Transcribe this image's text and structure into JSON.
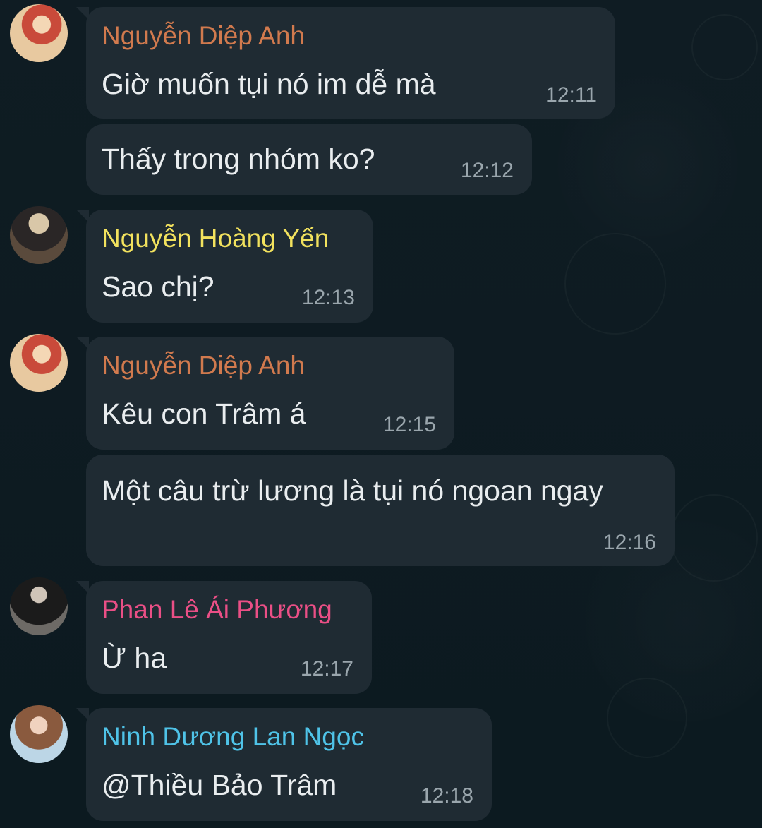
{
  "colors": {
    "background": "#0e1b22",
    "bubble": "#1f2b33",
    "text": "#e9edef",
    "time": "#9aa6ad"
  },
  "messages": [
    {
      "sender": "Nguyễn Diệp Anh",
      "sender_color": "#d17a4e",
      "avatar": "avatar-red-hair",
      "text": "Giờ muốn tụi nó im dễ mà",
      "time": "12:11"
    },
    {
      "text": "Thấy trong nhóm ko?",
      "time": "12:12"
    },
    {
      "sender": "Nguyễn Hoàng Yến",
      "sender_color": "#f2e25e",
      "avatar": "avatar-blonde-dark-jacket",
      "text": "Sao chị?",
      "time": "12:13"
    },
    {
      "sender": "Nguyễn Diệp Anh",
      "sender_color": "#d17a4e",
      "avatar": "avatar-red-hair",
      "text": "Kêu con Trâm á",
      "time": "12:15"
    },
    {
      "text": "Một câu trừ lương là tụi nó ngoan ngay",
      "time": "12:16"
    },
    {
      "sender": "Phan Lê Ái Phương",
      "sender_color": "#ea4f86",
      "avatar": "avatar-sunglasses",
      "text": "Ừ ha",
      "time": "12:17"
    },
    {
      "sender": "Ninh Dương Lan Ngọc",
      "sender_color": "#4fc3e8",
      "avatar": "avatar-long-hair",
      "text": "@Thiều Bảo Trâm",
      "time": "12:18"
    }
  ]
}
